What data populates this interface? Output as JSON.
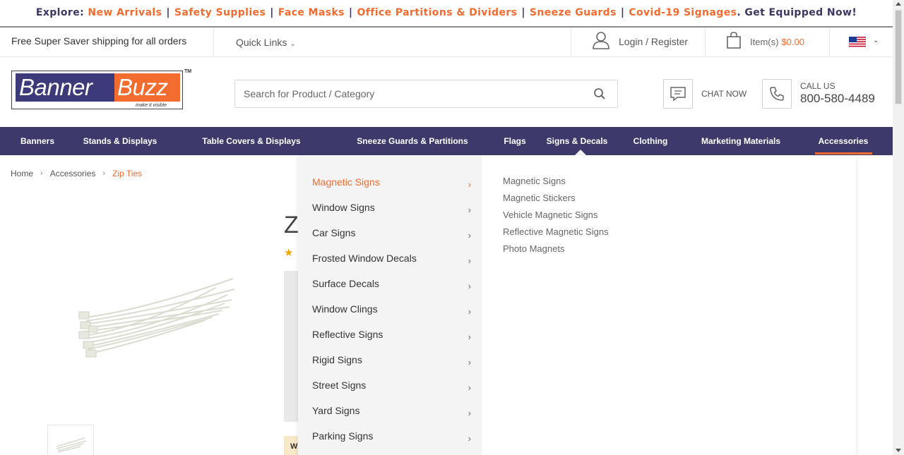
{
  "promo": {
    "prefix": "Explore:",
    "links": [
      "New Arrivals",
      "Safety Supplies",
      "Face Masks",
      "Office Partitions & Dividers",
      "Sneeze Guards",
      "Covid-19 Signages"
    ],
    "separator": "|",
    "suffix": ". Get Equipped Now!"
  },
  "utility": {
    "shipping_text": "Free Super Saver shipping for all orders",
    "quick_links": "Quick Links",
    "login": "Login / Register",
    "cart_label": "Item(s)",
    "cart_total": "$0.00"
  },
  "header": {
    "logo_word1": "Banner",
    "logo_word2": "Buzz",
    "logo_tagline": "make it visible",
    "logo_tm": "TM",
    "search_placeholder": "Search for Product / Category",
    "chat_label": "CHAT NOW",
    "call_label": "CALL US",
    "phone": "800-580-4489"
  },
  "nav": {
    "items": [
      "Banners",
      "Stands & Displays",
      "Table Covers & Displays",
      "Sneeze Guards & Partitions",
      "Flags",
      "Signs & Decals",
      "Clothing",
      "Marketing Materials",
      "Accessories"
    ],
    "open_item": "Signs & Decals",
    "active_item": "Accessories"
  },
  "breadcrumb": {
    "items": [
      "Home",
      "Accessories",
      "Zip Ties"
    ]
  },
  "product": {
    "title_fragment": "Z",
    "button_fragment": "W"
  },
  "mega_menu": {
    "categories": [
      "Magnetic Signs",
      "Window Signs",
      "Car Signs",
      "Frosted Window Decals",
      "Surface Decals",
      "Window Clings",
      "Reflective Signs",
      "Rigid Signs",
      "Street Signs",
      "Yard Signs",
      "Parking Signs"
    ],
    "active_category": "Magnetic Signs",
    "subcategories": [
      "Magnetic Signs",
      "Magnetic Stickers",
      "Vehicle Magnetic Signs",
      "Reflective Magnetic Signs",
      "Photo Magnets"
    ]
  },
  "colors": {
    "brand_navy": "#3d3a6b",
    "brand_orange": "#f26b2f"
  }
}
